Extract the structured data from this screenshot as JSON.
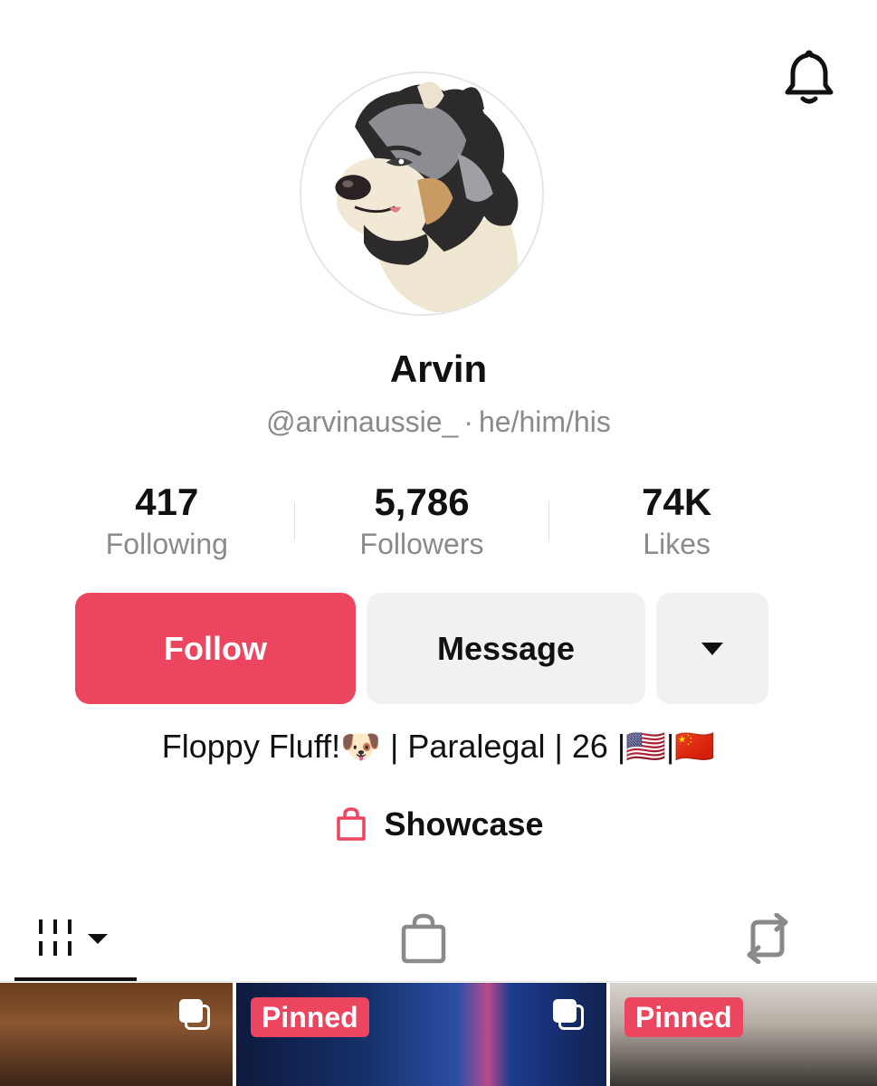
{
  "header": {
    "bell_icon": "bell-icon"
  },
  "profile": {
    "display_name": "Arvin",
    "handle": "@arvinaussie_",
    "separator": "·",
    "pronouns": "he/him/his",
    "avatar_icon": "dog-avatar"
  },
  "stats": [
    {
      "value": "417",
      "label": "Following"
    },
    {
      "value": "5,786",
      "label": "Followers"
    },
    {
      "value": "74K",
      "label": "Likes"
    }
  ],
  "actions": {
    "follow_label": "Follow",
    "message_label": "Message",
    "more_icon": "caret-down-icon"
  },
  "bio": "Floppy Fluff!🐶 | Paralegal | 26 |🇺🇸|🇨🇳",
  "showcase": {
    "label": "Showcase",
    "icon": "shopping-bag-icon"
  },
  "tabs": [
    {
      "icon": "videos-grid-icon",
      "selected": true
    },
    {
      "icon": "shopping-bag-icon",
      "selected": false
    },
    {
      "icon": "repost-icon",
      "selected": false
    }
  ],
  "videos": [
    {
      "pinned": false,
      "badge": "",
      "multi": true
    },
    {
      "pinned": true,
      "badge": "Pinned",
      "multi": true
    },
    {
      "pinned": true,
      "badge": "Pinned",
      "multi": false
    }
  ],
  "colors": {
    "accent": "#eb4560",
    "secondary_button": "#f1f1f2",
    "muted_text": "#8a8a8a"
  }
}
